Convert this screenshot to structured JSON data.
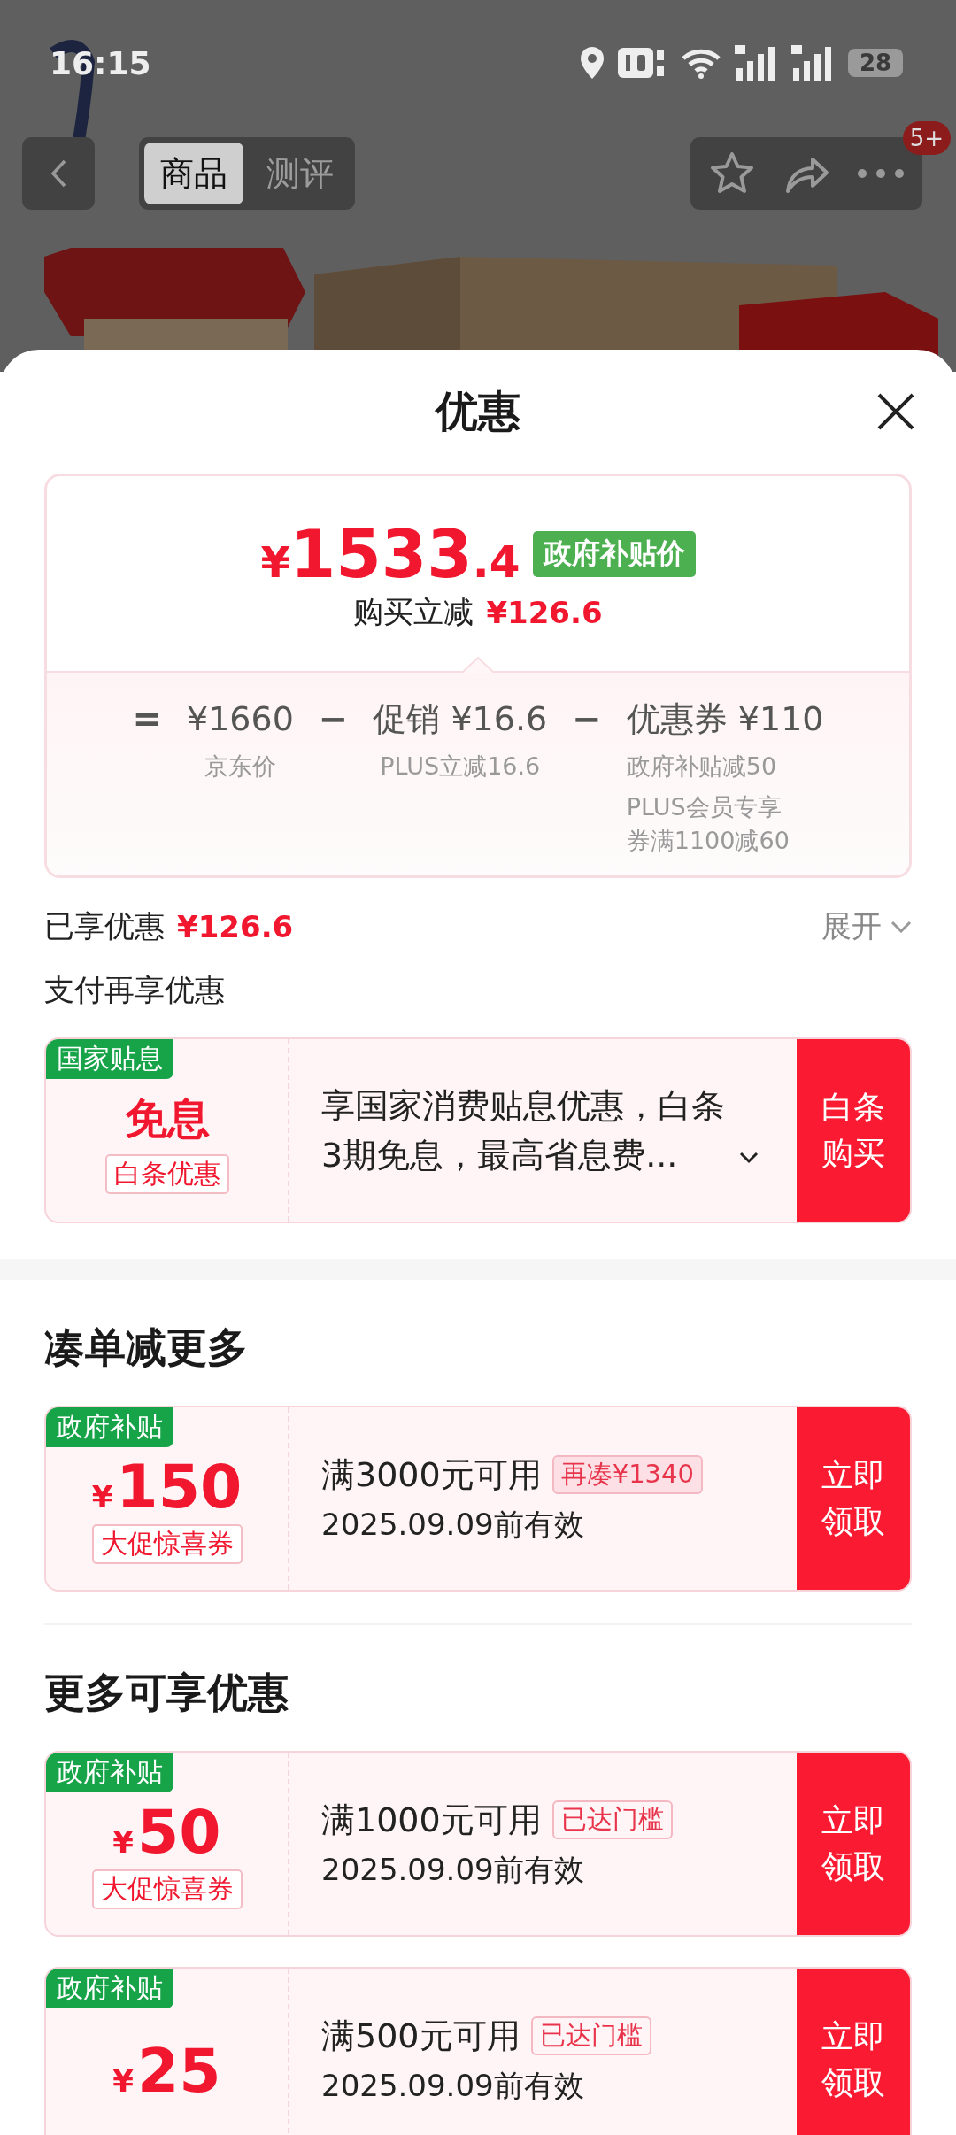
{
  "status_bar": {
    "time": "16:15",
    "battery": "28"
  },
  "header": {
    "tabs": [
      {
        "label": "商品",
        "selected": true
      },
      {
        "label": "测评",
        "selected": false
      }
    ],
    "badge": "5+"
  },
  "sheet": {
    "title": "优惠",
    "price_card": {
      "currency": "¥",
      "price_main": "1533",
      "price_decimal": ".4",
      "price_tag": "政府补贴价",
      "saving_label": "购买立减",
      "saving_amount": "¥126.6",
      "breakdown": [
        {
          "operator": "=",
          "amount": "¥1660",
          "notes": [
            "京东价"
          ]
        },
        {
          "operator": "−",
          "amount": "促销 ¥16.6",
          "notes": [
            "PLUS立减16.6"
          ]
        },
        {
          "operator": "−",
          "amount": "优惠券 ¥110",
          "notes": [
            "政府补贴减50",
            "PLUS会员专享券满1100减60"
          ]
        }
      ]
    },
    "applied": {
      "label": "已享优惠",
      "amount": "¥126.6",
      "expand": "展开"
    },
    "pay": {
      "heading": "支付再享优惠",
      "tag": "国家贴息",
      "title": "免息",
      "subtitle": "白条优惠",
      "description": "享国家消费贴息优惠，白条3期免息，最高省息费...",
      "button": "白条购买"
    },
    "sections": [
      {
        "heading": "凑单减更多",
        "coupons": [
          {
            "tag": "政府补贴",
            "currency": "¥",
            "amount": "150",
            "type": "大促惊喜券",
            "condition": "满3000元可用",
            "badge": "再凑¥1340",
            "badge_filled": true,
            "validity": "2025.09.09前有效",
            "button": "立即领取"
          }
        ]
      },
      {
        "heading": "更多可享优惠",
        "coupons": [
          {
            "tag": "政府补贴",
            "currency": "¥",
            "amount": "50",
            "type": "大促惊喜券",
            "condition": "满1000元可用",
            "badge": "已达门槛",
            "badge_filled": false,
            "validity": "2025.09.09前有效",
            "button": "立即领取"
          },
          {
            "tag": "政府补贴",
            "currency": "¥",
            "amount": "25",
            "condition": "满500元可用",
            "badge": "已达门槛",
            "badge_filled": false,
            "validity": "2025.09.09前有效",
            "button": "立即领取"
          }
        ]
      }
    ]
  }
}
